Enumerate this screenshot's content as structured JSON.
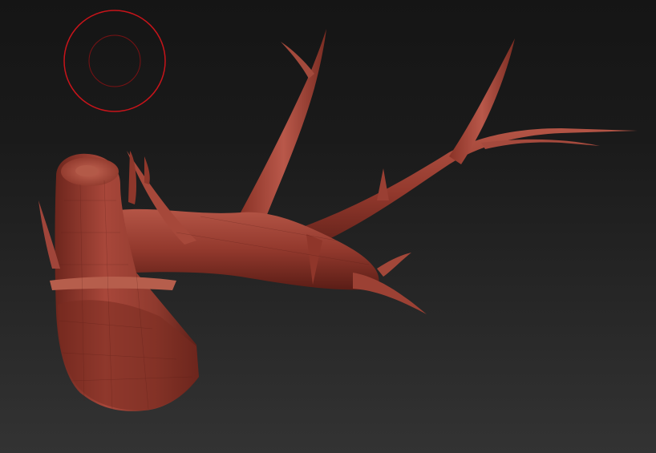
{
  "viewport": {
    "background_top": "#151515",
    "background_bottom": "#333333"
  },
  "brush_cursor": {
    "icon": "brush-cursor-icon",
    "color": "#c8141a"
  },
  "model": {
    "icon": "antler-mesh",
    "base_color": "#9a3a2e",
    "shadow_color": "#5e1f18",
    "highlight_color": "#c86a58"
  }
}
